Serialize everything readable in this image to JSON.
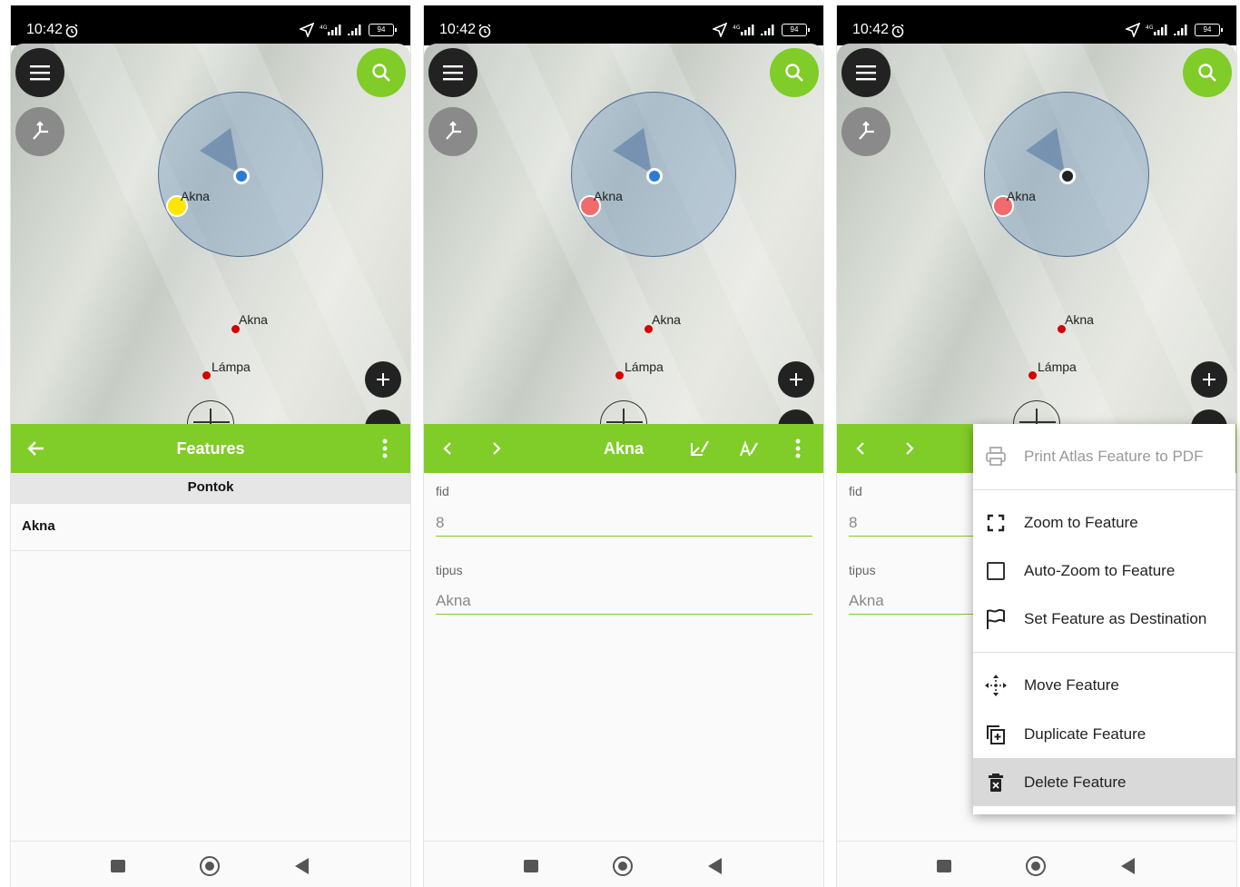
{
  "status": {
    "time": "10:42",
    "battery": "94",
    "network": "4G"
  },
  "map": {
    "label_a": "Akna",
    "label_b": "Akna",
    "label_c": "Lámpa"
  },
  "panel1": {
    "title": "Features",
    "section": "Pontok",
    "items": [
      {
        "label": "Akna"
      }
    ]
  },
  "panel2": {
    "title": "Akna",
    "fields": [
      {
        "label": "fid",
        "value": "8"
      },
      {
        "label": "tipus",
        "value": "Akna"
      }
    ]
  },
  "panel3": {
    "fields": [
      {
        "label": "fid",
        "value": "8"
      },
      {
        "label": "tipus",
        "value": "Akna"
      }
    ],
    "menu": [
      {
        "label": "Print Atlas Feature to PDF",
        "icon": "printer-icon",
        "disabled": true
      },
      {
        "label": "Zoom to Feature",
        "icon": "zoom-frame-icon"
      },
      {
        "label": "Auto-Zoom to Feature",
        "icon": "checkbox-icon"
      },
      {
        "label": "Set Feature as Destination",
        "icon": "flag-icon"
      },
      {
        "label": "Move Feature",
        "icon": "move-icon"
      },
      {
        "label": "Duplicate Feature",
        "icon": "duplicate-icon"
      },
      {
        "label": "Delete Feature",
        "icon": "trash-icon",
        "highlighted": true
      }
    ]
  },
  "colors": {
    "accent": "#80cc28",
    "point": "#d40000",
    "selected_yellow": "#ffe600",
    "selected_pink": "#f06b6b"
  }
}
